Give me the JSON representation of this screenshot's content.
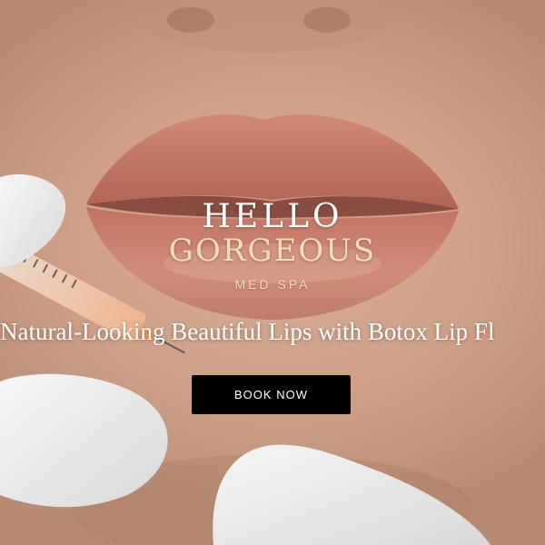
{
  "hero": {
    "brand": {
      "line1": "HELLO",
      "line2": "GORGEOUS",
      "line3": "MED SPA"
    },
    "tagline": "Natural-Looking Beautiful Lips with Botox Lip Fl",
    "cta_label": "BOOK NOW",
    "colors": {
      "accent_gold": "#f4dfb8",
      "button_bg": "#000000",
      "button_text": "#ffffff",
      "skin_tone": "#d8ad95",
      "lip_tone": "#c87a66"
    },
    "image_icon": "lips-syringe-photo"
  }
}
